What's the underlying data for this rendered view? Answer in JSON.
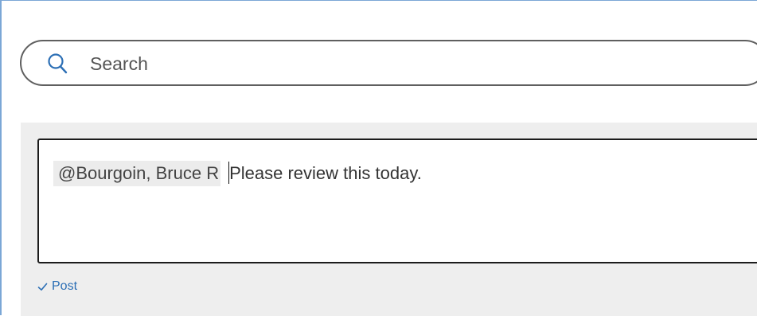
{
  "search": {
    "placeholder": "Search",
    "icon": "search-icon"
  },
  "comment": {
    "mention": "@Bourgoin, Bruce R",
    "text": "Please review this today."
  },
  "actions": {
    "post_label": "Post",
    "post_icon": "checkmark-icon"
  },
  "colors": {
    "accent": "#2c6fb5",
    "panel_background": "#eeeeee",
    "frame_border": "#7ba7d6"
  }
}
